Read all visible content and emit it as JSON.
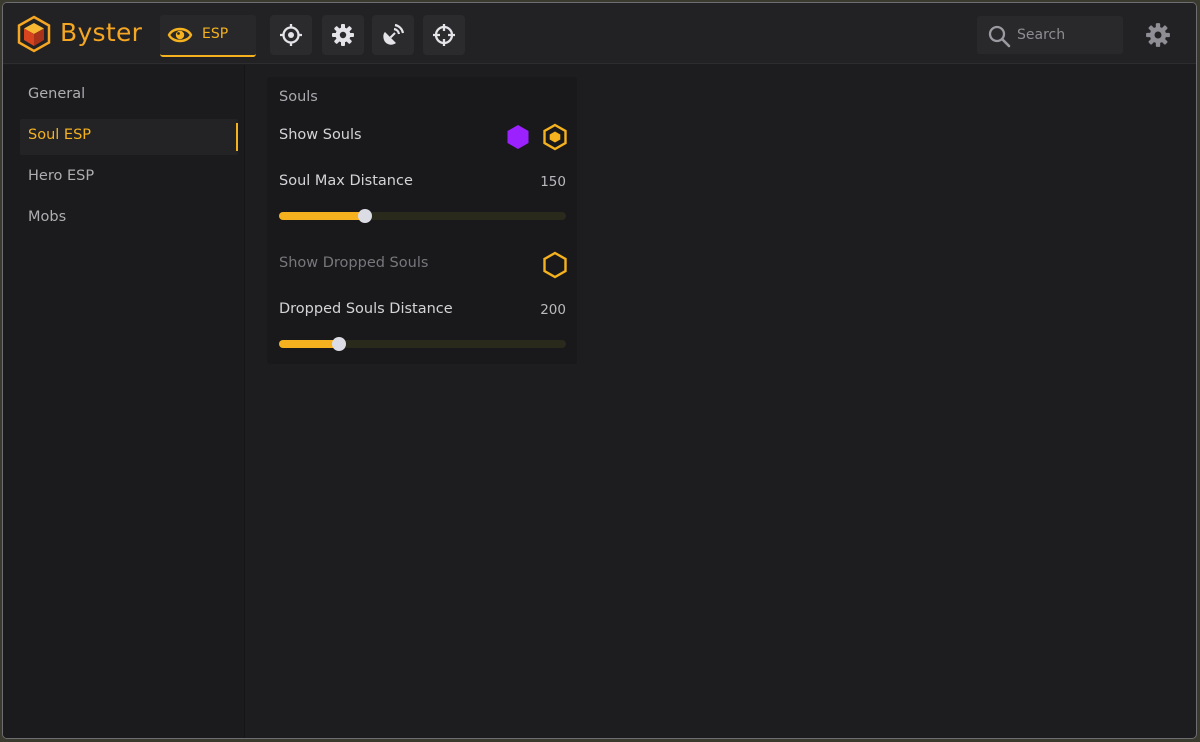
{
  "app": {
    "brand": "Byster"
  },
  "colors": {
    "accent": "#f5b21e",
    "purple": "#9b21ff",
    "background": "#1d1d1f"
  },
  "topbar": {
    "active_tab": {
      "label": "ESP",
      "icon": "eye-icon"
    },
    "icon_tabs": [
      "target-icon",
      "settings-gear-icon",
      "radar-icon",
      "crosshair-icon"
    ],
    "search": {
      "placeholder": "Search",
      "value": ""
    },
    "settings_icon": "gear-icon"
  },
  "sidebar": {
    "items": [
      {
        "label": "General",
        "active": false
      },
      {
        "label": "Soul ESP",
        "active": true
      },
      {
        "label": "Hero ESP",
        "active": false
      },
      {
        "label": "Mobs",
        "active": false
      }
    ]
  },
  "panel": {
    "title": "Souls",
    "show_souls": {
      "label": "Show Souls",
      "enabled": true,
      "color": "#9b21ff"
    },
    "soul_max_distance": {
      "label": "Soul Max Distance",
      "value": "150",
      "fraction": 0.3
    },
    "show_dropped_souls": {
      "label": "Show Dropped Souls",
      "enabled": false
    },
    "dropped_souls_distance": {
      "label": "Dropped Souls Distance",
      "value": "200",
      "fraction": 0.21
    }
  }
}
